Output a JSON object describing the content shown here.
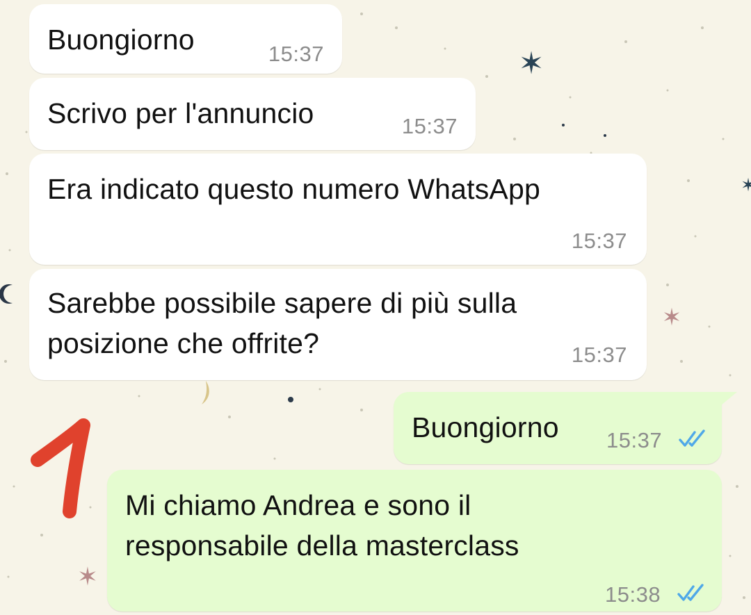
{
  "chat": {
    "messages": [
      {
        "direction": "incoming",
        "text": "Buongiorno",
        "time": "15:37"
      },
      {
        "direction": "incoming",
        "text": "Scrivo per l'annuncio",
        "time": "15:37"
      },
      {
        "direction": "incoming",
        "text": "Era indicato questo numero WhatsApp",
        "time": "15:37"
      },
      {
        "direction": "incoming",
        "text": "Sarebbe possibile sapere di più sulla\nposizione che offrite?",
        "time": "15:37"
      },
      {
        "direction": "outgoing",
        "text": "Buongiorno",
        "time": "15:37",
        "status": "read",
        "status_icon": "double-check-icon"
      },
      {
        "direction": "outgoing",
        "text": "Mi chiamo Andrea e sono il\nresponsabile della masterclass",
        "time": "15:38",
        "status": "read",
        "status_icon": "double-check-icon"
      }
    ]
  },
  "annotation": {
    "label": "1",
    "color": "#e0422d"
  },
  "colors": {
    "incoming_bubble": "#ffffff",
    "outgoing_bubble": "#e5fcd0",
    "read_ticks": "#4fa8e8",
    "wallpaper": "#f7f4e8",
    "timestamp": "#8c8c8c"
  }
}
